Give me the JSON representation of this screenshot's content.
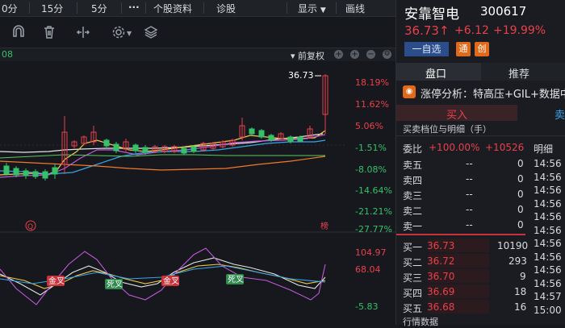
{
  "toolbar": {
    "tf_minutes_cut": "0分",
    "tf_15": "15分",
    "tf_5": "5分",
    "more": "···",
    "stock_info": "个股资料",
    "diagnose": "诊股",
    "display": "显示",
    "draw": "画线"
  },
  "indicator_bar": {
    "left_text": "08",
    "adjust": "前复权"
  },
  "kline": {
    "last_price_label": "36.73",
    "pct_labels": [
      "18.19%",
      "11.62%",
      "5.06%",
      "-1.51%",
      "-8.08%",
      "-14.64%",
      "-21.21%",
      "-27.77%"
    ],
    "pct_colors": [
      "#e8414b",
      "#e8414b",
      "#e8414b",
      "#35c06a",
      "#35c06a",
      "#35c06a",
      "#35c06a",
      "#35c06a"
    ],
    "marker_q": "Q",
    "marker_rank": "榜"
  },
  "kdj": {
    "top_value": "104.97",
    "mid_value": "68.04",
    "low_value": "-5.83",
    "golden_cross": "金叉",
    "death_cross": "死叉"
  },
  "stock": {
    "name": "安靠智电",
    "code": "300617",
    "price": "36.73↑",
    "change": "+6.12",
    "change_pct": "+19.99%",
    "watchlist_btn": "一自选",
    "tag_tong": "通",
    "tag_chuang": "创"
  },
  "tabs": {
    "pankou": "盘口",
    "recommend": "推荐"
  },
  "analysis": {
    "text": "涨停分析：特高压+GIL+数据中"
  },
  "trade_tabs": {
    "buy": "买入",
    "sell_cut": "卖"
  },
  "orderbook": {
    "title": "买卖档位与明细（手）",
    "ratio_label": "委比",
    "ratio_pct": "+100.00%",
    "ratio_diff": "+10526",
    "detail_col": "明细",
    "sells": [
      {
        "label": "卖五",
        "price": "--",
        "vol": "0"
      },
      {
        "label": "卖四",
        "price": "--",
        "vol": "0"
      },
      {
        "label": "卖三",
        "price": "--",
        "vol": "0"
      },
      {
        "label": "卖二",
        "price": "--",
        "vol": "0"
      },
      {
        "label": "卖一",
        "price": "--",
        "vol": "0"
      }
    ],
    "buys": [
      {
        "label": "买一",
        "price": "36.73",
        "vol": "10190"
      },
      {
        "label": "买二",
        "price": "36.72",
        "vol": "293"
      },
      {
        "label": "买三",
        "price": "36.70",
        "vol": "9"
      },
      {
        "label": "买四",
        "price": "36.69",
        "vol": "18"
      },
      {
        "label": "买五",
        "price": "36.68",
        "vol": "16"
      }
    ],
    "times": [
      "14:56",
      "14:56",
      "14:56",
      "14:56",
      "14:56",
      "14:56",
      "14:56",
      "14:56",
      "14:56",
      "14:56",
      "14:57",
      "15:00"
    ],
    "market_data": "行情数据"
  }
}
